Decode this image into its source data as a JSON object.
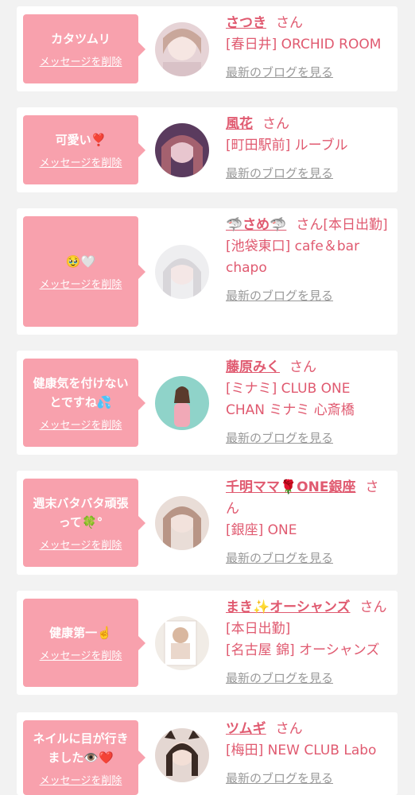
{
  "entries": [
    {
      "message": "カタツムリ",
      "delete_label": "メッセージを削除",
      "name": "さつき",
      "suffix": "さん",
      "shop": "[春日井] ORCHID ROOM",
      "blog": "最新のブログを見る"
    },
    {
      "message": "可愛い❣️",
      "delete_label": "メッセージを削除",
      "name": "風花",
      "suffix": "さん",
      "shop": "[町田駅前] ルーブル",
      "blog": "最新のブログを見る"
    },
    {
      "message": "🥹🤍",
      "delete_label": "メッセージを削除",
      "name": "🦈さめ🦈",
      "suffix": "さん[本日出勤]",
      "shop": "[池袋東口] cafe＆bar chapo",
      "blog": "最新のブログを見る"
    },
    {
      "message": "健康気を付けないとですね💦",
      "delete_label": "メッセージを削除",
      "name": "藤原みく",
      "suffix": "さん",
      "shop": "[ミナミ] CLUB ONE CHAN ミナミ 心斎橋",
      "blog": "最新のブログを見る"
    },
    {
      "message": "週末バタバタ頑張って🍀°",
      "delete_label": "メッセージを削除",
      "name": "千明ママ🌹ONE銀座",
      "suffix": "さん",
      "shop": "[銀座] ONE",
      "blog": "最新のブログを見る"
    },
    {
      "message": "健康第一☝️",
      "delete_label": "メッセージを削除",
      "name": "まき✨オーシャンズ",
      "suffix": "さん[本日出勤]",
      "shop": "[名古屋 錦] オーシャンズ",
      "blog": "最新のブログを見る"
    },
    {
      "message": "ネイルに目が行きました👁️❤️",
      "delete_label": "メッセージを削除",
      "name": "ツムギ",
      "suffix": "さん",
      "shop": "[梅田] NEW CLUB Labo",
      "blog": "最新のブログを見る"
    }
  ],
  "colors": {
    "bubble": "#f8a1ad",
    "name": "#e05a70",
    "muted": "#999999",
    "background": "#f2f2f2"
  }
}
